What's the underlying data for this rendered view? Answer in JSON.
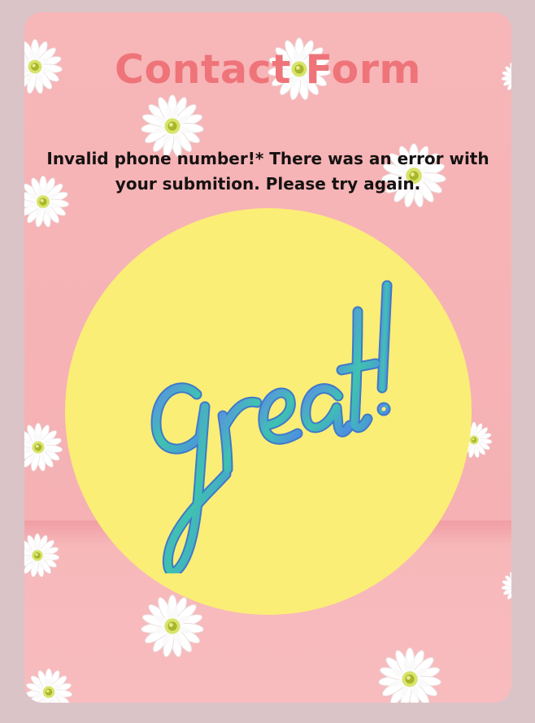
{
  "page": {
    "title": "Contact Form",
    "message": "Invalid phone number!* There was an error with your submition. Please try again."
  },
  "illustration": {
    "icon": "great-lettering-icon",
    "text": "great!",
    "circle_color": "#fbee76",
    "letter_colors": [
      "#4f8de0",
      "#43c3b2"
    ]
  },
  "background": {
    "icon": "daisy-flower-icon",
    "wall_color": "#f7b6b8",
    "outer_color": "#dbc4c8"
  },
  "colors": {
    "title": "#ee7479",
    "message": "#161212"
  }
}
